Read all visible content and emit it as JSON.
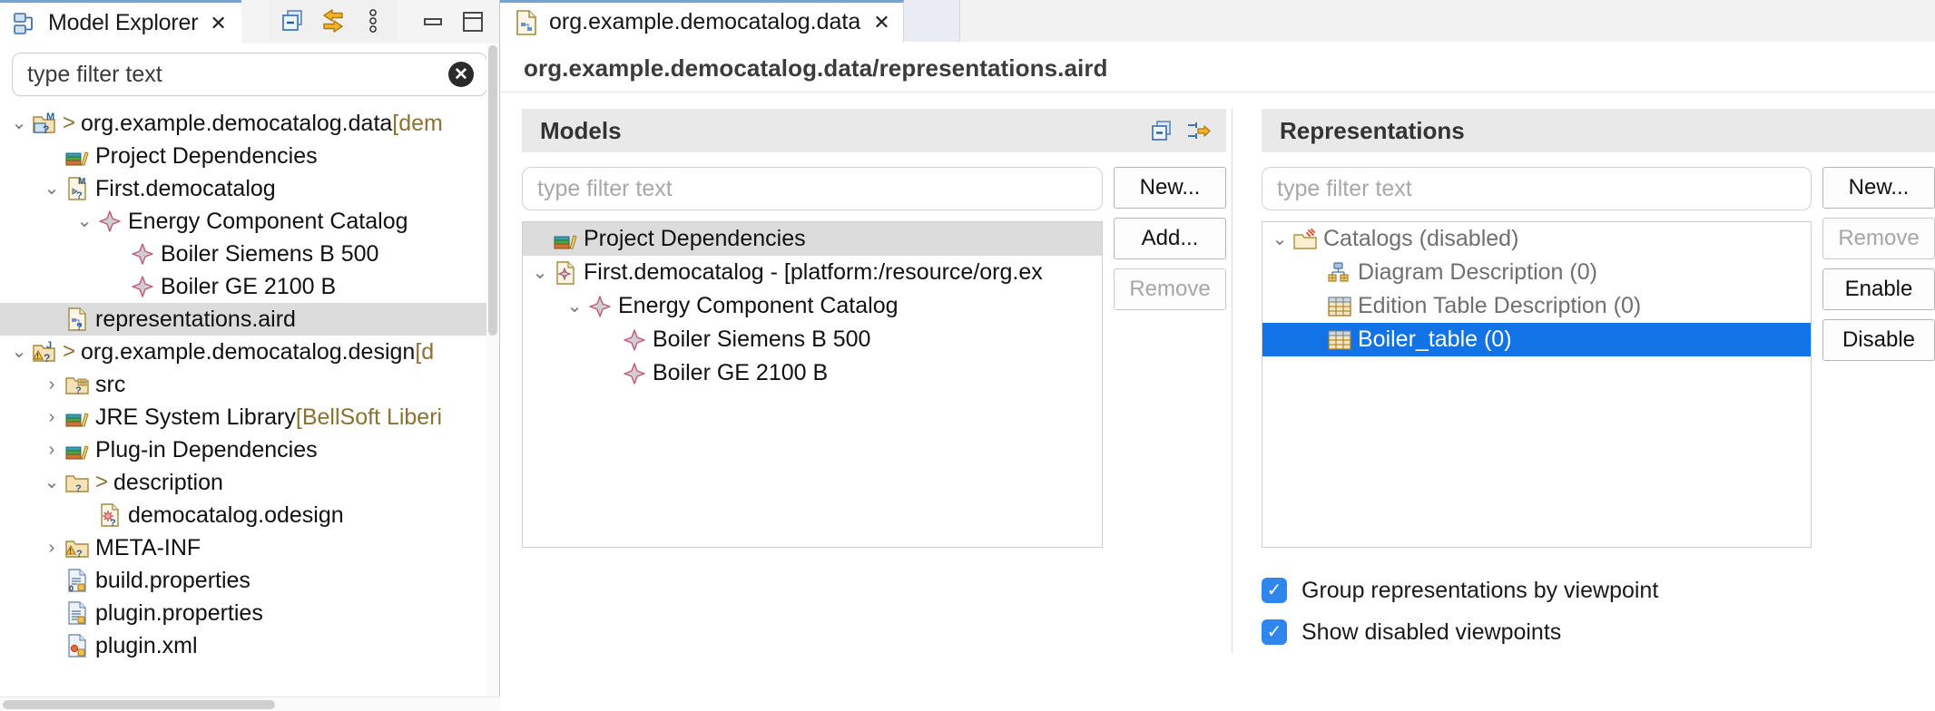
{
  "explorer": {
    "tab_title": "Model Explorer",
    "close_label": "✕",
    "toolbar": [
      {
        "name": "collapse-all-icon",
        "label": "collapse-all-icon"
      },
      {
        "name": "link-with-editor-icon",
        "label": "link-with-editor-icon"
      },
      {
        "name": "view-menu-icon",
        "label": "view-menu-icon"
      }
    ],
    "window_buttons": [
      {
        "name": "minimize-icon",
        "label": "minimize-icon"
      },
      {
        "name": "maximize-icon",
        "label": "maximize-icon"
      }
    ],
    "filter_placeholder": "type filter text",
    "filter_value": "type filter text",
    "tree": [
      {
        "indent": 0,
        "twist": "⌄",
        "icon": "project-model-icon",
        "arrow": ">",
        "label": "org.example.democatalog.data",
        "suffix": " [dem",
        "selected": false
      },
      {
        "indent": 1,
        "twist": "",
        "icon": "library-icon",
        "arrow": "",
        "label": "Project Dependencies",
        "suffix": "",
        "selected": false
      },
      {
        "indent": 1,
        "twist": "⌄",
        "icon": "democatalog-file-icon",
        "arrow": "",
        "label": "First.democatalog",
        "suffix": "",
        "selected": false
      },
      {
        "indent": 2,
        "twist": "⌄",
        "icon": "catalog-node-icon",
        "arrow": "",
        "label": "Energy Component Catalog",
        "suffix": "",
        "selected": false
      },
      {
        "indent": 3,
        "twist": "",
        "icon": "boiler-node-icon",
        "arrow": "",
        "label": "Boiler Siemens B 500",
        "suffix": "",
        "selected": false
      },
      {
        "indent": 3,
        "twist": "",
        "icon": "boiler-node-icon",
        "arrow": "",
        "label": "Boiler GE 2100 B",
        "suffix": "",
        "selected": false
      },
      {
        "indent": 1,
        "twist": "",
        "icon": "aird-file-icon",
        "arrow": "",
        "label": "representations.aird",
        "suffix": "",
        "selected": true
      },
      {
        "indent": 0,
        "twist": "⌄",
        "icon": "java-project-warning-icon",
        "arrow": ">",
        "label": "org.example.democatalog.design",
        "suffix": " [d",
        "selected": false
      },
      {
        "indent": 1,
        "twist": "›",
        "icon": "source-folder-icon",
        "arrow": "",
        "label": "src",
        "suffix": "",
        "selected": false
      },
      {
        "indent": 1,
        "twist": "›",
        "icon": "library-icon",
        "arrow": "",
        "label": "JRE System Library",
        "suffix": " [BellSoft Liberi",
        "selected": false
      },
      {
        "indent": 1,
        "twist": "›",
        "icon": "library-icon",
        "arrow": "",
        "label": "Plug-in Dependencies",
        "suffix": "",
        "selected": false
      },
      {
        "indent": 1,
        "twist": "⌄",
        "icon": "folder-icon",
        "arrow": ">",
        "label": "description",
        "suffix": "",
        "selected": false
      },
      {
        "indent": 2,
        "twist": "",
        "icon": "odesign-file-icon",
        "arrow": "",
        "label": "democatalog.odesign",
        "suffix": "",
        "selected": false
      },
      {
        "indent": 1,
        "twist": "›",
        "icon": "meta-inf-folder-warning-icon",
        "arrow": "",
        "label": "META-INF",
        "suffix": "",
        "selected": false
      },
      {
        "indent": 1,
        "twist": "",
        "icon": "build-properties-icon",
        "arrow": "",
        "label": "build.properties",
        "suffix": "",
        "selected": false
      },
      {
        "indent": 1,
        "twist": "",
        "icon": "properties-file-icon",
        "arrow": "",
        "label": "plugin.properties",
        "suffix": "",
        "selected": false
      },
      {
        "indent": 1,
        "twist": "",
        "icon": "plugin-xml-icon",
        "arrow": "",
        "label": "plugin.xml",
        "suffix": "",
        "selected": false
      }
    ]
  },
  "editor": {
    "tab_title": "org.example.democatalog.data",
    "tab_close_label": "✕",
    "header_title": "org.example.democatalog.data/representations.aird"
  },
  "models": {
    "group_title": "Models",
    "header_icons": [
      {
        "name": "collapse-all-icon",
        "label": "collapse-all-icon"
      },
      {
        "name": "link-with-editor-icon",
        "label": "link-with-editor-icon"
      }
    ],
    "filter_placeholder": "type filter text",
    "buttons": [
      {
        "label": "New...",
        "name": "models-new-button",
        "disabled": false
      },
      {
        "label": "Add...",
        "name": "models-add-button",
        "disabled": false
      },
      {
        "label": "Remove",
        "name": "models-remove-button",
        "disabled": true
      }
    ],
    "tree": [
      {
        "indent": 0,
        "twist": "",
        "icon": "library-icon",
        "label": "Project Dependencies",
        "state": "selected-grey"
      },
      {
        "indent": 0,
        "twist": "⌄",
        "icon": "democatalog-model-icon",
        "label": "First.democatalog - [platform:/resource/org.ex",
        "state": ""
      },
      {
        "indent": 1,
        "twist": "⌄",
        "icon": "catalog-node-icon",
        "label": "Energy Component Catalog",
        "state": ""
      },
      {
        "indent": 2,
        "twist": "",
        "icon": "boiler-node-icon",
        "label": "Boiler Siemens B 500",
        "state": ""
      },
      {
        "indent": 2,
        "twist": "",
        "icon": "boiler-node-icon",
        "label": "Boiler GE 2100 B",
        "state": ""
      }
    ]
  },
  "representations": {
    "group_title": "Representations",
    "filter_placeholder": "type filter text",
    "buttons": [
      {
        "label": "New...",
        "name": "reps-new-button",
        "disabled": false
      },
      {
        "label": "Remove",
        "name": "reps-remove-button",
        "disabled": true
      },
      {
        "label": "Enable",
        "name": "reps-enable-button",
        "disabled": false
      },
      {
        "label": "Disable",
        "name": "reps-disable-button",
        "disabled": false
      }
    ],
    "tree": [
      {
        "indent": 0,
        "twist": "⌄",
        "icon": "viewpoint-disabled-icon",
        "label": "Catalogs (disabled)",
        "state": "muted"
      },
      {
        "indent": 1,
        "twist": "",
        "icon": "diagram-description-icon",
        "label": "Diagram Description (0)",
        "state": "muted"
      },
      {
        "indent": 1,
        "twist": "",
        "icon": "table-description-icon",
        "label": "Edition Table Description (0)",
        "state": "muted"
      },
      {
        "indent": 1,
        "twist": "",
        "icon": "table-description-icon",
        "label": "Boiler_table (0)",
        "state": "selected-blue"
      }
    ],
    "checkboxes": [
      {
        "label": "Group representations by viewpoint",
        "checked": true,
        "name": "group-by-viewpoint-checkbox"
      },
      {
        "label": "Show disabled viewpoints",
        "checked": true,
        "name": "show-disabled-viewpoints-checkbox"
      }
    ],
    "check_glyph": "✓"
  },
  "colors": {
    "selection_blue": "#1273e6",
    "selection_grey": "#dcdcdc",
    "tab_accent": "#7a9fd4",
    "checkbox_blue": "#2f86ec"
  }
}
